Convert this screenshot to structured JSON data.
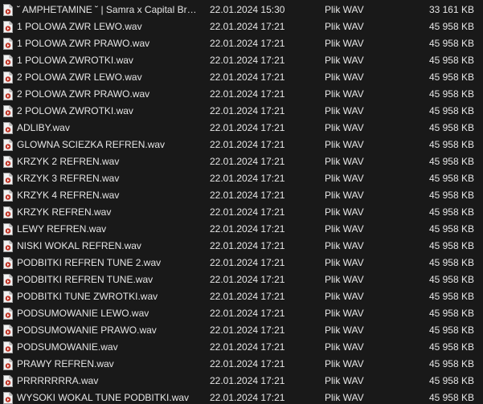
{
  "colors": {
    "background": "#191919",
    "text": "#e6e6e6",
    "icon_accent": "#c0392b"
  },
  "files": [
    {
      "name": "˘ AMPHETAMINE ˘  |  Samra x Capital Bra Type Beat.wav",
      "modified": "22.01.2024 15:30",
      "type": "Plik WAV",
      "size": "33 161 KB",
      "icon": "wav-file-icon"
    },
    {
      "name": "1 POLOWA ZWR LEWO.wav",
      "modified": "22.01.2024 17:21",
      "type": "Plik WAV",
      "size": "45 958 KB",
      "icon": "wav-file-icon"
    },
    {
      "name": "1 POLOWA ZWR PRAWO.wav",
      "modified": "22.01.2024 17:21",
      "type": "Plik WAV",
      "size": "45 958 KB",
      "icon": "wav-file-icon"
    },
    {
      "name": "1 POLOWA ZWROTKI.wav",
      "modified": "22.01.2024 17:21",
      "type": "Plik WAV",
      "size": "45 958 KB",
      "icon": "wav-file-icon"
    },
    {
      "name": "2 POLOWA ZWR LEWO.wav",
      "modified": "22.01.2024 17:21",
      "type": "Plik WAV",
      "size": "45 958 KB",
      "icon": "wav-file-icon"
    },
    {
      "name": "2 POLOWA ZWR PRAWO.wav",
      "modified": "22.01.2024 17:21",
      "type": "Plik WAV",
      "size": "45 958 KB",
      "icon": "wav-file-icon"
    },
    {
      "name": "2 POLOWA ZWROTKI.wav",
      "modified": "22.01.2024 17:21",
      "type": "Plik WAV",
      "size": "45 958 KB",
      "icon": "wav-file-icon"
    },
    {
      "name": "ADLIBY.wav",
      "modified": "22.01.2024 17:21",
      "type": "Plik WAV",
      "size": "45 958 KB",
      "icon": "wav-file-icon"
    },
    {
      "name": "GLOWNA SCIEZKA REFREN.wav",
      "modified": "22.01.2024 17:21",
      "type": "Plik WAV",
      "size": "45 958 KB",
      "icon": "wav-file-icon"
    },
    {
      "name": "KRZYK 2 REFREN.wav",
      "modified": "22.01.2024 17:21",
      "type": "Plik WAV",
      "size": "45 958 KB",
      "icon": "wav-file-icon"
    },
    {
      "name": "KRZYK 3 REFREN.wav",
      "modified": "22.01.2024 17:21",
      "type": "Plik WAV",
      "size": "45 958 KB",
      "icon": "wav-file-icon"
    },
    {
      "name": "KRZYK 4 REFREN.wav",
      "modified": "22.01.2024 17:21",
      "type": "Plik WAV",
      "size": "45 958 KB",
      "icon": "wav-file-icon"
    },
    {
      "name": "KRZYK REFREN.wav",
      "modified": "22.01.2024 17:21",
      "type": "Plik WAV",
      "size": "45 958 KB",
      "icon": "wav-file-icon"
    },
    {
      "name": "LEWY REFREN.wav",
      "modified": "22.01.2024 17:21",
      "type": "Plik WAV",
      "size": "45 958 KB",
      "icon": "wav-file-icon"
    },
    {
      "name": "NISKI WOKAL REFREN.wav",
      "modified": "22.01.2024 17:21",
      "type": "Plik WAV",
      "size": "45 958 KB",
      "icon": "wav-file-icon"
    },
    {
      "name": "PODBITKI REFREN TUNE 2.wav",
      "modified": "22.01.2024 17:21",
      "type": "Plik WAV",
      "size": "45 958 KB",
      "icon": "wav-file-icon"
    },
    {
      "name": "PODBITKI REFREN TUNE.wav",
      "modified": "22.01.2024 17:21",
      "type": "Plik WAV",
      "size": "45 958 KB",
      "icon": "wav-file-icon"
    },
    {
      "name": "PODBITKI TUNE ZWROTKI.wav",
      "modified": "22.01.2024 17:21",
      "type": "Plik WAV",
      "size": "45 958 KB",
      "icon": "wav-file-icon"
    },
    {
      "name": "PODSUMOWANIE LEWO.wav",
      "modified": "22.01.2024 17:21",
      "type": "Plik WAV",
      "size": "45 958 KB",
      "icon": "wav-file-icon"
    },
    {
      "name": "PODSUMOWANIE PRAWO.wav",
      "modified": "22.01.2024 17:21",
      "type": "Plik WAV",
      "size": "45 958 KB",
      "icon": "wav-file-icon"
    },
    {
      "name": "PODSUMOWANIE.wav",
      "modified": "22.01.2024 17:21",
      "type": "Plik WAV",
      "size": "45 958 KB",
      "icon": "wav-file-icon"
    },
    {
      "name": "PRAWY REFREN.wav",
      "modified": "22.01.2024 17:21",
      "type": "Plik WAV",
      "size": "45 958 KB",
      "icon": "wav-file-icon"
    },
    {
      "name": "PRRRRRRRA.wav",
      "modified": "22.01.2024 17:21",
      "type": "Plik WAV",
      "size": "45 958 KB",
      "icon": "wav-file-icon"
    },
    {
      "name": "WYSOKI WOKAL TUNE PODBITKI.wav",
      "modified": "22.01.2024 17:21",
      "type": "Plik WAV",
      "size": "45 958 KB",
      "icon": "wav-file-icon"
    }
  ]
}
